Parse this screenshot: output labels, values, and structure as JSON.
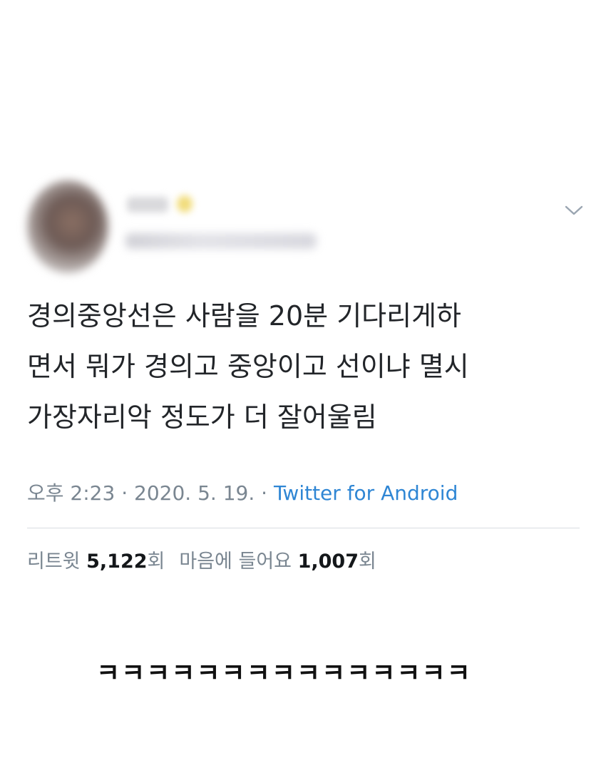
{
  "tweet": {
    "text": "경의중앙선은 사람을 20분 기다리게하\n면서 뭐가 경의고 중앙이고 선이냐 멸시\n가장자리악 정도가 더 잘어울림",
    "time": "오후 2:23",
    "date": "2020. 5. 19.",
    "separator": "·",
    "source": "Twitter for Android",
    "retweet_label": "리트윗",
    "retweet_count": "5,122",
    "count_suffix": "회",
    "like_label": "마음에 들어요",
    "like_count": "1,007"
  },
  "icons": {
    "menu": "chevron-down-icon"
  },
  "caption": "ㅋㅋㅋㅋㅋㅋㅋㅋㅋㅋㅋㅋㅋㅋㅋ",
  "colors": {
    "source_link": "#2f86d4",
    "meta_text": "#7a8691",
    "divider": "#d8dde1"
  }
}
